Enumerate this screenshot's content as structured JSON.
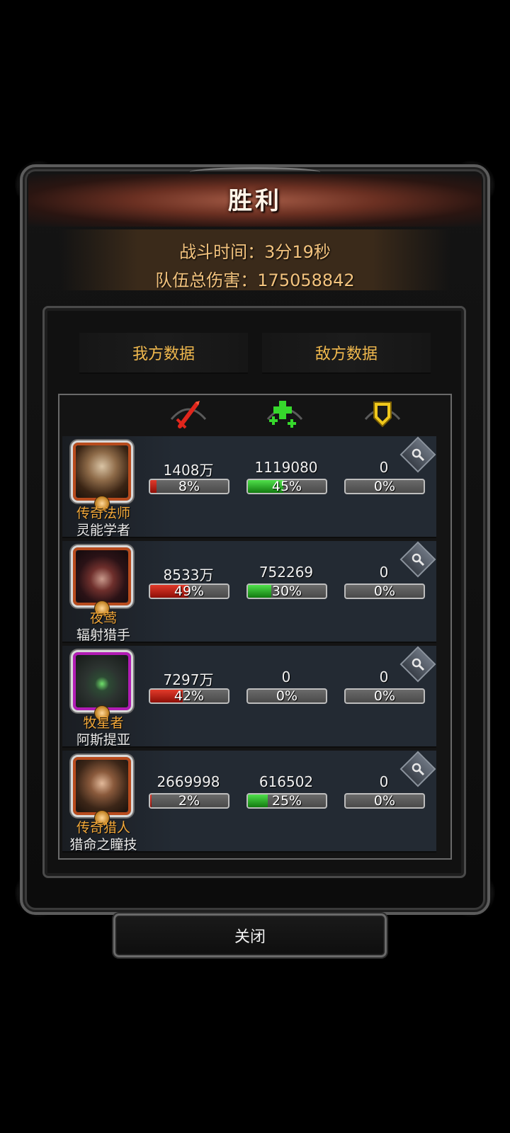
{
  "header": {
    "title": "胜利",
    "battle_time": "战斗时间：3分19秒",
    "team_damage": "队伍总伤害：175058842"
  },
  "tabs": [
    {
      "label": "我方数据"
    },
    {
      "label": "敌方数据"
    }
  ],
  "columns": {
    "damage_icon": "red-sword-icon",
    "heal_icon": "green-cross-icon",
    "tank_icon": "yellow-shield-icon"
  },
  "colors": {
    "damage_bar": "#c22a1c",
    "heal_bar": "#2fb02a",
    "role_text": "#f2a83a",
    "tab_text": "#f1b94e"
  },
  "heroes": [
    {
      "role": "传奇法师",
      "name": "灵能学者",
      "frame": "orange",
      "damage": "1408万",
      "damage_pct": "8%",
      "damage_frac": 0.08,
      "heal": "1119080",
      "heal_pct": "45%",
      "heal_frac": 0.45,
      "tank": "0",
      "tank_pct": "0%",
      "tank_frac": 0
    },
    {
      "role": "夜莺",
      "name": "辐射猎手",
      "frame": "orange",
      "damage": "8533万",
      "damage_pct": "49%",
      "damage_frac": 0.49,
      "heal": "752269",
      "heal_pct": "30%",
      "heal_frac": 0.3,
      "tank": "0",
      "tank_pct": "0%",
      "tank_frac": 0
    },
    {
      "role": "牧星者",
      "name": "阿斯提亚",
      "frame": "purple",
      "damage": "7297万",
      "damage_pct": "42%",
      "damage_frac": 0.42,
      "heal": "0",
      "heal_pct": "0%",
      "heal_frac": 0,
      "tank": "0",
      "tank_pct": "0%",
      "tank_frac": 0
    },
    {
      "role": "传奇猎人",
      "name": "猎命之瞳技",
      "frame": "orange",
      "damage": "2669998",
      "damage_pct": "2%",
      "damage_frac": 0.02,
      "heal": "616502",
      "heal_pct": "25%",
      "heal_frac": 0.25,
      "tank": "0",
      "tank_pct": "0%",
      "tank_frac": 0
    }
  ],
  "close_label": "关闭"
}
